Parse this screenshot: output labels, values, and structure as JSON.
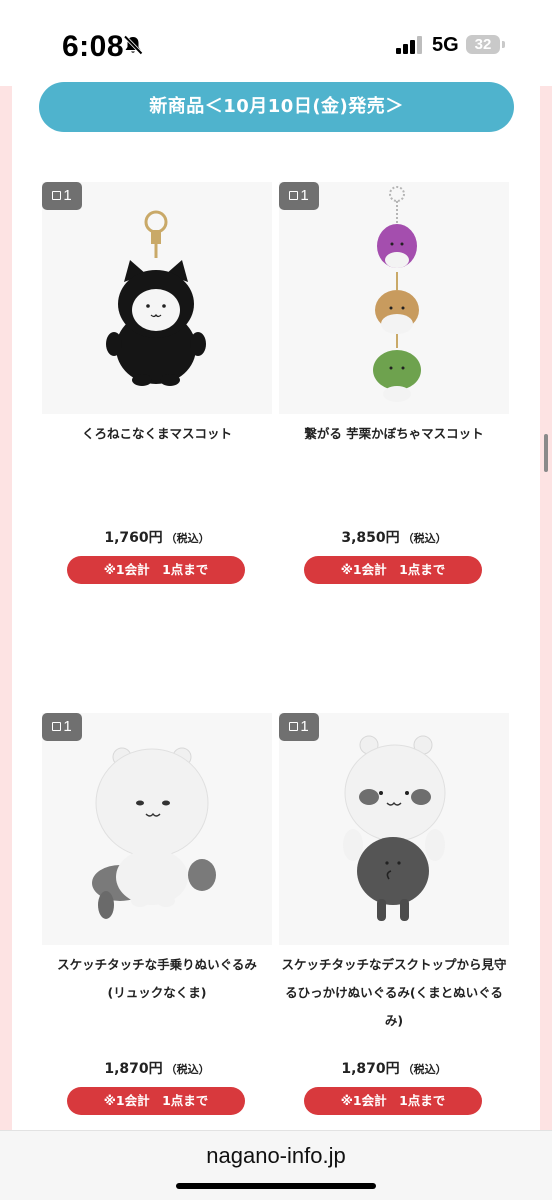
{
  "status_bar": {
    "time": "6:08",
    "network": "5G",
    "battery": "32"
  },
  "banner": {
    "text": "新商品＜10月10日(金)発売＞"
  },
  "products": [
    {
      "badge": "1",
      "name_lines": [
        "くろねこなくまマスコット"
      ],
      "price": "1,760円",
      "tax": "（税込）",
      "limit": "※1会計　1点まで"
    },
    {
      "badge": "1",
      "name_lines": [
        "繋がる 芋栗かぼちゃマスコット"
      ],
      "price": "3,850円",
      "tax": "（税込）",
      "limit": "※1会計　1点まで"
    },
    {
      "badge": "1",
      "name_lines": [
        "スケッチタッチな手乗りぬいぐるみ",
        "(リュックなくま)"
      ],
      "price": "1,870円",
      "tax": "（税込）",
      "limit": "※1会計　1点まで"
    },
    {
      "badge": "1",
      "name_lines": [
        "スケッチタッチなデスクトップから見守",
        "るひっかけぬいぐるみ(くまとぬいぐる",
        "み)"
      ],
      "price": "1,870円",
      "tax": "（税込）",
      "limit": "※1会計　1点まで"
    }
  ],
  "url_bar": {
    "url": "nagano-info.jp"
  }
}
